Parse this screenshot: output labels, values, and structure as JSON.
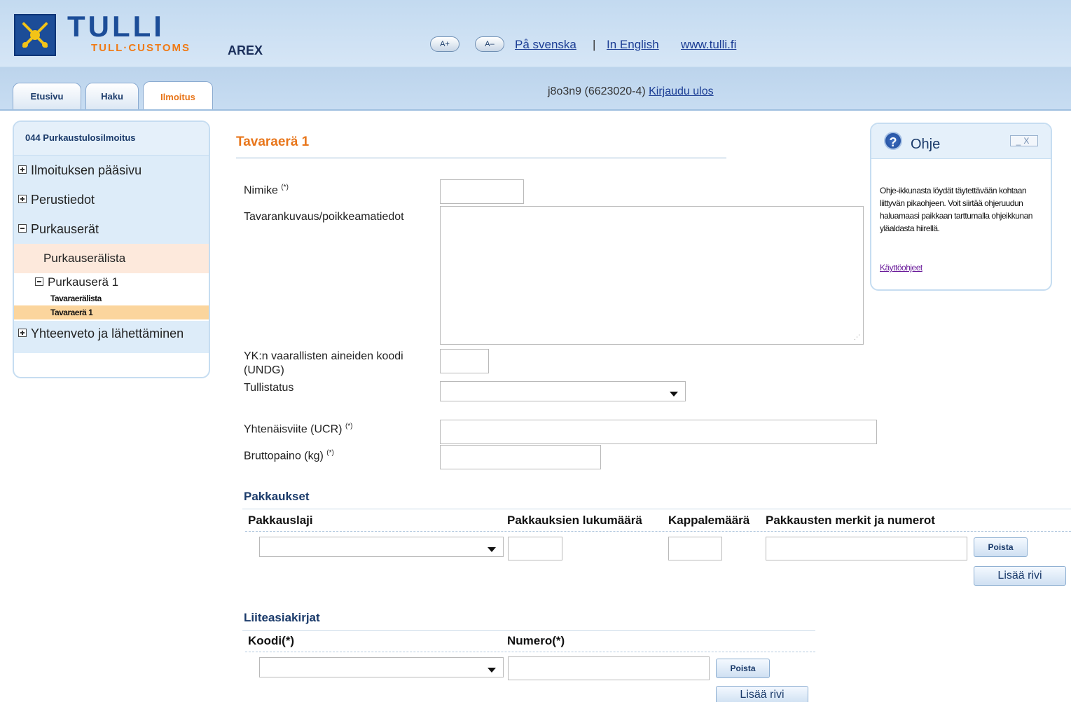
{
  "header": {
    "brand": "TULLI",
    "brand_sub": "TULL·CUSTOMS",
    "app_name": "AREX",
    "font_increase": "A+",
    "font_decrease": "A–",
    "lang_swedish": "På svenska",
    "separator": "|",
    "lang_english": "In English",
    "site_link": "www.tulli.fi",
    "user_info": "j8o3n9 (6623020-4)",
    "logout": "Kirjaudu ulos"
  },
  "tabs": [
    {
      "label": "Etusivu",
      "active": false
    },
    {
      "label": "Haku",
      "active": false
    },
    {
      "label": "Ilmoitus",
      "active": true
    }
  ],
  "nav": {
    "title": "044 Purkaustulosilmoitus",
    "items": [
      {
        "label": "Ilmoituksen pääsivu",
        "icon": "plus-box-icon"
      },
      {
        "label": "Perustiedot",
        "icon": "plus-box-icon"
      },
      {
        "label": "Purkauserät",
        "icon": "minus-box-icon"
      }
    ],
    "purkauseralista": "Purkauserälista",
    "purkausera": "Purkauserä 1",
    "tavaraeralista": "Tavaraerälista",
    "tavaraera": "Tavaraerä 1",
    "summary": "Yhteenveto ja lähettäminen"
  },
  "form": {
    "title": "Tavaraerä 1",
    "nimike_label": "Nimike",
    "required_mark": "(*)",
    "description_label": "Tavarankuvaus/poikkeamatiedot",
    "undg_label": "YK:n vaarallisten aineiden koodi (UNDG)",
    "tullistatus_label": "Tullistatus",
    "ucr_label": "Yhtenäisviite (UCR)",
    "weight_label": "Bruttopaino (kg)"
  },
  "packages": {
    "title": "Pakkaukset",
    "columns": [
      "Pakkauslaji",
      "Pakkauksien lukumäärä",
      "Kappalemäärä",
      "Pakkausten merkit ja numerot"
    ],
    "remove_button": "Poista",
    "add_button": "Lisää rivi"
  },
  "attachments": {
    "title": "Liiteasiakirjat",
    "columns": [
      "Koodi(*)",
      "Numero(*)"
    ],
    "remove_button": "Poista",
    "add_button": "Lisää rivi"
  },
  "help": {
    "title": "Ohje",
    "window_controls": "_X",
    "text": "Ohje-ikkunasta löydät täytettävään kohtaan liittyvän pikaohjeen. Voit siirtää ohjeruudun haluamaasi paikkaan tarttumalla ohjeikkunan yläaldasta hiirellä.",
    "link": "Käyttöohjeet"
  },
  "colors": {
    "brand_blue": "#1c4d98",
    "accent_orange": "#e8761b",
    "header_bg": "#c8ddf2",
    "nav_bg": "#ddecf9"
  }
}
